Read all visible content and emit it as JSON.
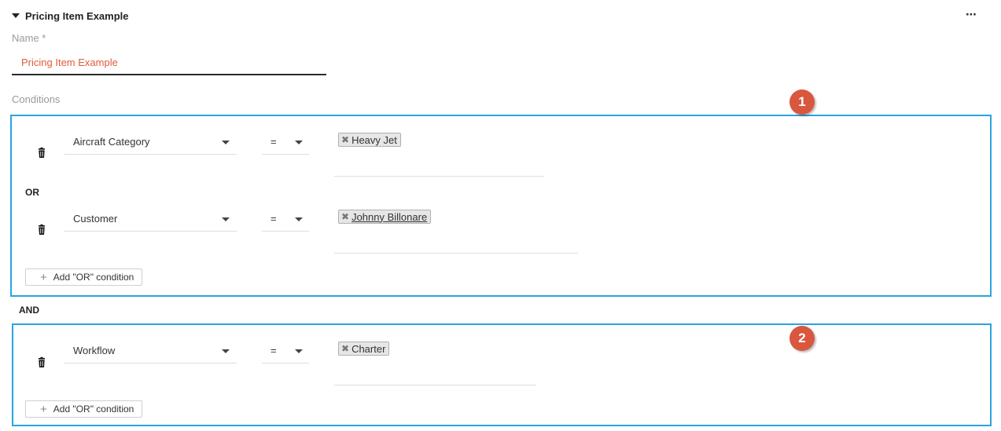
{
  "section": {
    "title": "Pricing Item Example",
    "more_label": "⋯"
  },
  "name_field": {
    "label": "Name *",
    "value": "Pricing Item Example"
  },
  "conditions_label": "Conditions",
  "groups": [
    {
      "badge": "1",
      "rows": [
        {
          "field": "Aircraft Category",
          "operator": "=",
          "values": [
            "Heavy Jet"
          ]
        },
        {
          "field": "Customer",
          "operator": "=",
          "values": [
            "Johnny Billonare"
          ]
        }
      ],
      "or_label": "OR",
      "add_or_label": "Add \"OR\" condition"
    },
    {
      "badge": "2",
      "rows": [
        {
          "field": "Workflow",
          "operator": "=",
          "values": [
            "Charter"
          ]
        }
      ],
      "add_or_label": "Add \"OR\" condition"
    }
  ],
  "and_label": "AND",
  "colors": {
    "accent_border": "#29a5e0",
    "badge": "#d9573e",
    "name_value": "#e35a3c"
  },
  "icons": {
    "trash": "trash-icon",
    "remove_tag": "close-icon",
    "caret": "caret-down-icon",
    "plus": "plus-icon"
  }
}
